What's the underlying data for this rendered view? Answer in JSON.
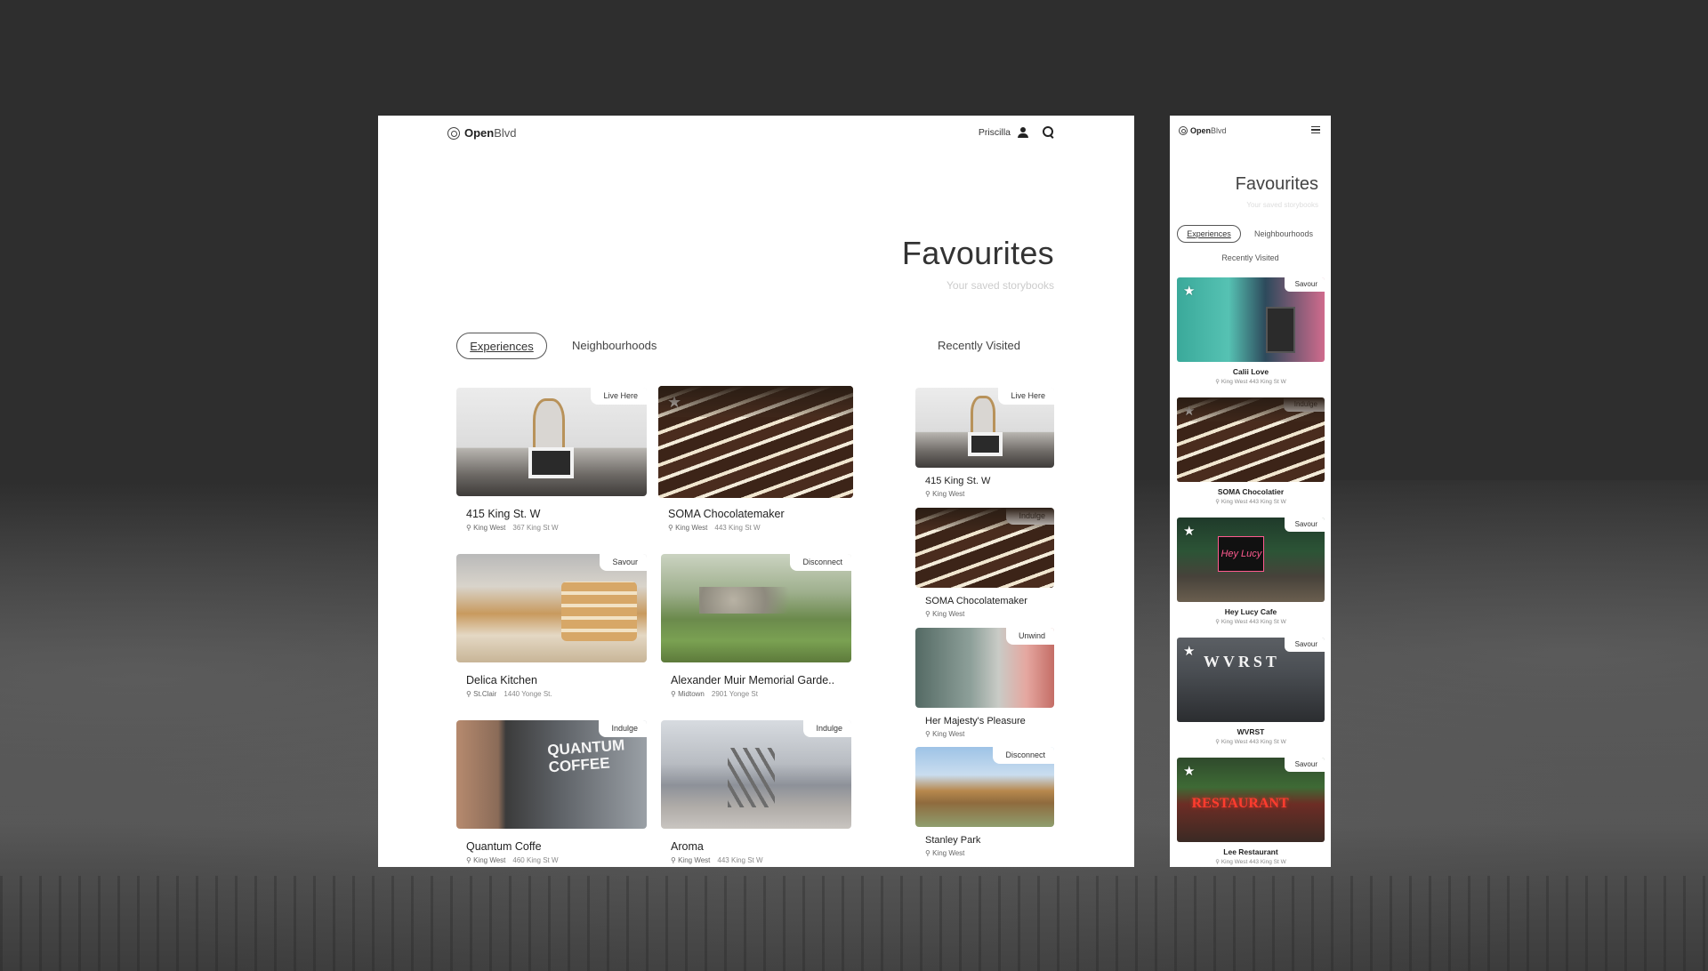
{
  "desktop": {
    "brand": {
      "part1": "Open",
      "part2": "Blvd"
    },
    "nav": {
      "user_name": "Priscilla"
    },
    "title": "Favourites",
    "subtitle": "Your saved storybooks",
    "tabs": {
      "experiences": "Experiences",
      "neighbourhoods": "Neighbourhoods",
      "recent": "Recently Visited"
    },
    "cards": [
      {
        "tag": "Live Here",
        "name": "415 King St. W",
        "hood": "King West",
        "address": "367 King St W",
        "image": "interior",
        "starred": false
      },
      {
        "tag": "",
        "name": "SOMA Chocolatemaker",
        "hood": "King West",
        "address": "443 King St W",
        "image": "chocolate",
        "starred": true
      },
      {
        "tag": "Savour",
        "name": "Delica Kitchen",
        "hood": "St.Clair",
        "address": "1440 Yonge St.",
        "image": "bakery",
        "starred": false
      },
      {
        "tag": "Disconnect",
        "name": "Alexander Muir Memorial Garde..",
        "hood": "Midtown",
        "address": "2901 Yonge St",
        "image": "garden",
        "starred": false
      },
      {
        "tag": "Indulge",
        "name": "Quantum Coffe",
        "hood": "King West",
        "address": "460 King St W",
        "image": "coffee",
        "starred": false
      },
      {
        "tag": "Indulge",
        "name": "Aroma",
        "hood": "King West",
        "address": "443 King St W",
        "image": "street",
        "starred": false
      }
    ],
    "recent": [
      {
        "tag": "Live Here",
        "name": "415 King St. W",
        "hood": "King West",
        "image": "interior"
      },
      {
        "tag": "Indulge",
        "name": "SOMA Chocolatemaker",
        "hood": "King West",
        "image": "chocolate"
      },
      {
        "tag": "Unwind",
        "name": "Her Majesty's Pleasure",
        "hood": "King West",
        "image": "store"
      },
      {
        "tag": "Disconnect",
        "name": "Stanley Park",
        "hood": "King West",
        "image": "park"
      }
    ]
  },
  "mobile": {
    "brand": {
      "part1": "Open",
      "part2": "Blvd"
    },
    "title": "Favourites",
    "subtitle": "Your saved storybooks",
    "tabs": {
      "experiences": "Experiences",
      "neighbourhoods": "Neighbourhoods",
      "recent": "Recently Visited"
    },
    "cards": [
      {
        "tag": "Savour",
        "name": "Calii Love",
        "hood": "King West",
        "address": "443 King St W",
        "image": "calii"
      },
      {
        "tag": "Indulge",
        "name": "SOMA Chocolatier",
        "hood": "King West",
        "address": "443 King St W",
        "image": "chocolate"
      },
      {
        "tag": "Savour",
        "name": "Hey Lucy Cafe",
        "hood": "King West",
        "address": "443 King St W",
        "image": "heylucy"
      },
      {
        "tag": "Savour",
        "name": "WVRST",
        "hood": "King West",
        "address": "443 King St W",
        "image": "wvrst"
      },
      {
        "tag": "Savour",
        "name": "Lee Restaurant",
        "hood": "King West",
        "address": "443 King St W",
        "image": "lee"
      }
    ]
  },
  "icons": {
    "logo": "openblvd-logo-icon",
    "user": "user-icon",
    "search": "search-icon",
    "menu": "hamburger-icon",
    "star": "star-icon",
    "pin": "location-pin-icon"
  }
}
